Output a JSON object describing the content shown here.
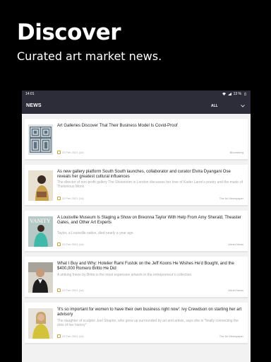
{
  "promo": {
    "title": "Discover",
    "subtitle": "Curated art market news."
  },
  "status_bar": {
    "time": "14:01",
    "battery": "13 %"
  },
  "app_bar": {
    "title": "NEWS",
    "filter_value": "ALL"
  },
  "articles": [
    {
      "title": "Art Galleries Discover That Their Business Model Is Covid-Proof",
      "description": "",
      "date": "23 Feb 2021 (1d)",
      "source": "Bloomberg",
      "thumbnail_icon": "geometric-artwork"
    },
    {
      "title": "As new gallery platform South South launches, collaborator and curator Elvira Dyangani Ose reveals her greatest cultural influences",
      "description": "The director of non-profit gallery The Showroom in London discusses her love of Kader Lanre's poetry and the music of Thelonious Monk",
      "date": "22 Feb 2021 (1d)",
      "source": "The Art Newspaper",
      "thumbnail_icon": "portrait-painting"
    },
    {
      "title": "A Louisville Museum Is Staging a Show on Breonna Taylor With Help From Amy Sherald, Theaster Gates, and Other Art Experts",
      "description": "Taylor, a Louisville native, died nearly a year ago.",
      "date": "23 Feb 2021 (1d)",
      "source": "Artnet News",
      "thumbnail_icon": "magazine-cover"
    },
    {
      "title": "What I Buy and Why: Hotelier Rami Fustok on the Jeff Koons He Wishes He'd Bought, and the $400,000 Romero Britto He Did",
      "description": "A striking frieze by Britto is the most expensive artwork in the entrepreneur's collection.",
      "date": "23 Feb 2021 (1d)",
      "source": "Artnet News",
      "thumbnail_icon": "person-photo"
    },
    {
      "title": "'It's so important for women to have their own business right now': Ivy Crewdson on starting her art advisory",
      "description": "The daughter of sculptor Joel Shapiro, who grew up surrounded by art and artists, says she is \"finally connecting the dots of her history\"",
      "date": "23 Feb 2021 (1d)",
      "source": "The Art Newspaper",
      "thumbnail_icon": "person-photo"
    }
  ]
}
